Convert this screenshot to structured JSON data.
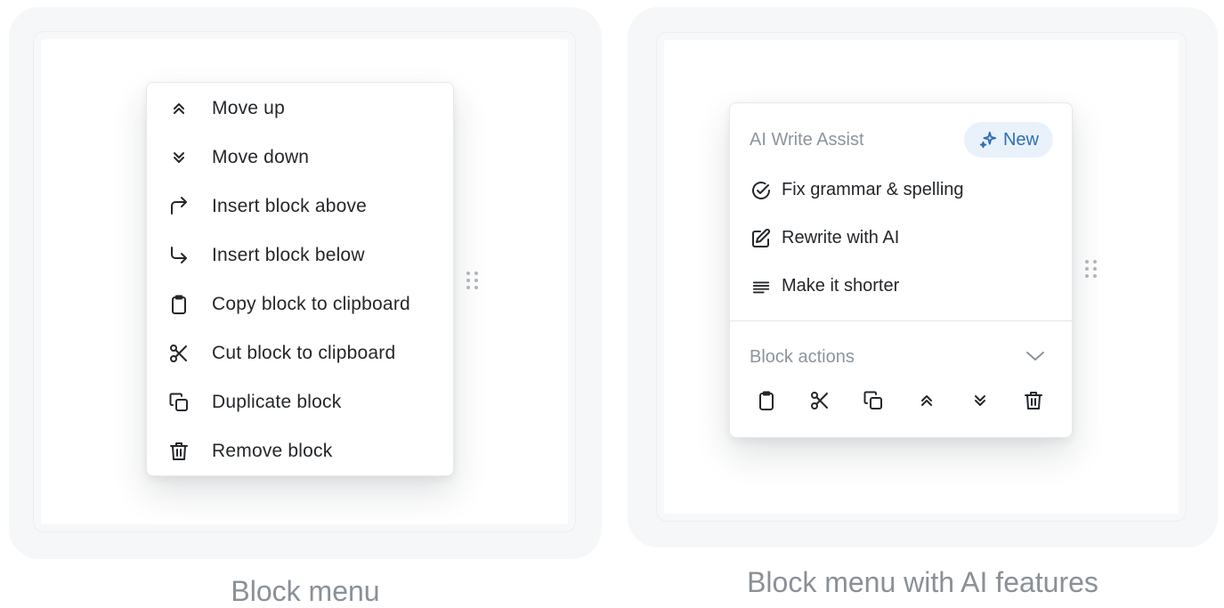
{
  "panels": [
    {
      "caption": "Block menu",
      "menu": {
        "items": [
          {
            "icon": "chevrons-up-icon",
            "label": "Move up"
          },
          {
            "icon": "chevrons-down-icon",
            "label": "Move down"
          },
          {
            "icon": "arrow-corner-up-right-icon",
            "label": "Insert block above"
          },
          {
            "icon": "arrow-corner-down-right-icon",
            "label": "Insert block below"
          },
          {
            "icon": "clipboard-icon",
            "label": "Copy block to clipboard"
          },
          {
            "icon": "scissors-icon",
            "label": "Cut block to clipboard"
          },
          {
            "icon": "duplicate-icon",
            "label": "Duplicate block"
          },
          {
            "icon": "trash-icon",
            "label": "Remove block"
          }
        ]
      }
    },
    {
      "caption": "Block menu with AI features",
      "ai_section": {
        "title": "AI Write Assist",
        "badge": "New",
        "badge_icon": "sparkles-icon",
        "badge_color": "#2f6fb3",
        "items": [
          {
            "icon": "check-circle-icon",
            "label": "Fix grammar & spelling"
          },
          {
            "icon": "edit-icon",
            "label": "Rewrite with AI"
          },
          {
            "icon": "align-text-icon",
            "label": "Make it shorter"
          }
        ]
      },
      "block_actions": {
        "title": "Block actions",
        "toggle_icon": "chevron-down-icon",
        "actions": [
          "clipboard-icon",
          "scissors-icon",
          "duplicate-icon",
          "chevrons-up-icon",
          "chevrons-down-icon",
          "trash-icon"
        ]
      }
    }
  ],
  "colors": {
    "panel_bg": "#f6f7f8",
    "menu_border": "#e6e8eb",
    "text": "#23272b",
    "muted": "#8c949c",
    "badge_bg": "#e9f2fb"
  }
}
